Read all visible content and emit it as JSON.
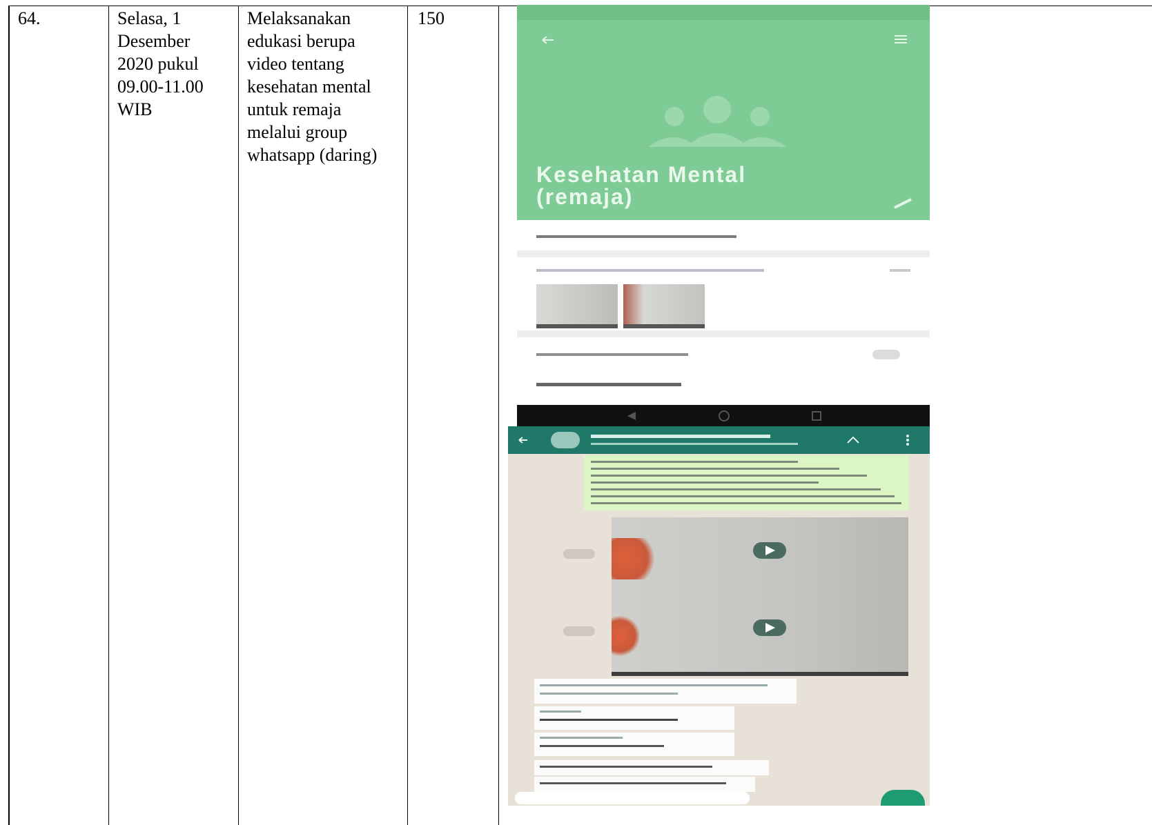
{
  "row": {
    "number": "64.",
    "date_lines": [
      "Selasa, 1",
      "Desember",
      "2020 pukul",
      "09.00-11.00",
      "WIB"
    ],
    "activity_lines": [
      "Melaksanakan",
      "edukasi berupa",
      "video tentang",
      "kesehatan mental",
      "untuk remaja",
      "melalui group",
      "whatsapp (daring)"
    ],
    "count": "150"
  },
  "evidence": {
    "group_info": {
      "group_title_lines": [
        "Kesehatan Mental",
        "(remaja)"
      ]
    },
    "chat": {
      "header_color": "#1f7868"
    },
    "colors": {
      "group_header": "#7fcb95",
      "chat_bg": "#e7e1d8",
      "sent_bubble": "#dcf5c4"
    }
  }
}
